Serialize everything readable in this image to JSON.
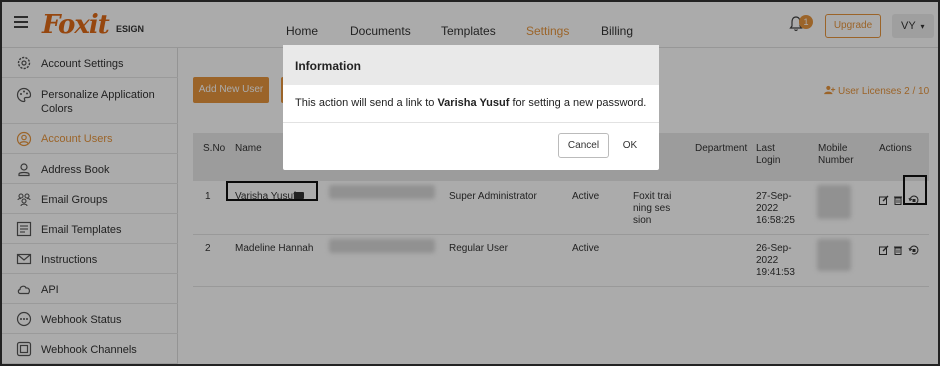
{
  "header": {
    "logo_text": "Foxit",
    "logo_sub": "ESIGN",
    "nav": [
      "Home",
      "Documents",
      "Templates",
      "Settings",
      "Billing"
    ],
    "notification_count": "1",
    "upgrade_label": "Upgrade",
    "user_initials": "VY",
    "accent_color": "#e8963e"
  },
  "sidebar": {
    "items": [
      {
        "label": "Account Settings",
        "icon": "gear-icon"
      },
      {
        "label": "Personalize Application Colors",
        "icon": "palette-icon"
      },
      {
        "label": "Account Users",
        "icon": "user-icon"
      },
      {
        "label": "Address Book",
        "icon": "contact-icon"
      },
      {
        "label": "Email Groups",
        "icon": "group-icon"
      },
      {
        "label": "Email Templates",
        "icon": "template-icon"
      },
      {
        "label": "Instructions",
        "icon": "mail-icon"
      },
      {
        "label": "API",
        "icon": "cloud-icon"
      },
      {
        "label": "Webhook Status",
        "icon": "webhook-icon"
      },
      {
        "label": "Webhook Channels",
        "icon": "webhook-channel-icon"
      }
    ],
    "active_index": 2
  },
  "main": {
    "add_user_label": "Add New User",
    "licenses_label": "User Licenses 2 / 10",
    "table": {
      "headers": {
        "sno": "S.No",
        "name": "Name",
        "department": "Department",
        "last_login": "Last Login",
        "mobile": "Mobile Number",
        "actions": "Actions"
      },
      "rows": [
        {
          "sno": "1",
          "name": "Varisha Yusuf",
          "role": "Super Administrator",
          "status": "Active",
          "training": "Foxit training session",
          "last_login": "27-Sep-2022 16:58:25"
        },
        {
          "sno": "2",
          "name": "Madeline Hannah",
          "role": "Regular User",
          "status": "Active",
          "training": "",
          "last_login": "26-Sep-2022 19:41:53"
        }
      ]
    }
  },
  "modal": {
    "title": "Information",
    "body_prefix": "This action will send a link to ",
    "body_name": "Varisha Yusuf",
    "body_suffix": " for setting a new password.",
    "cancel_label": "Cancel",
    "ok_label": "OK"
  }
}
